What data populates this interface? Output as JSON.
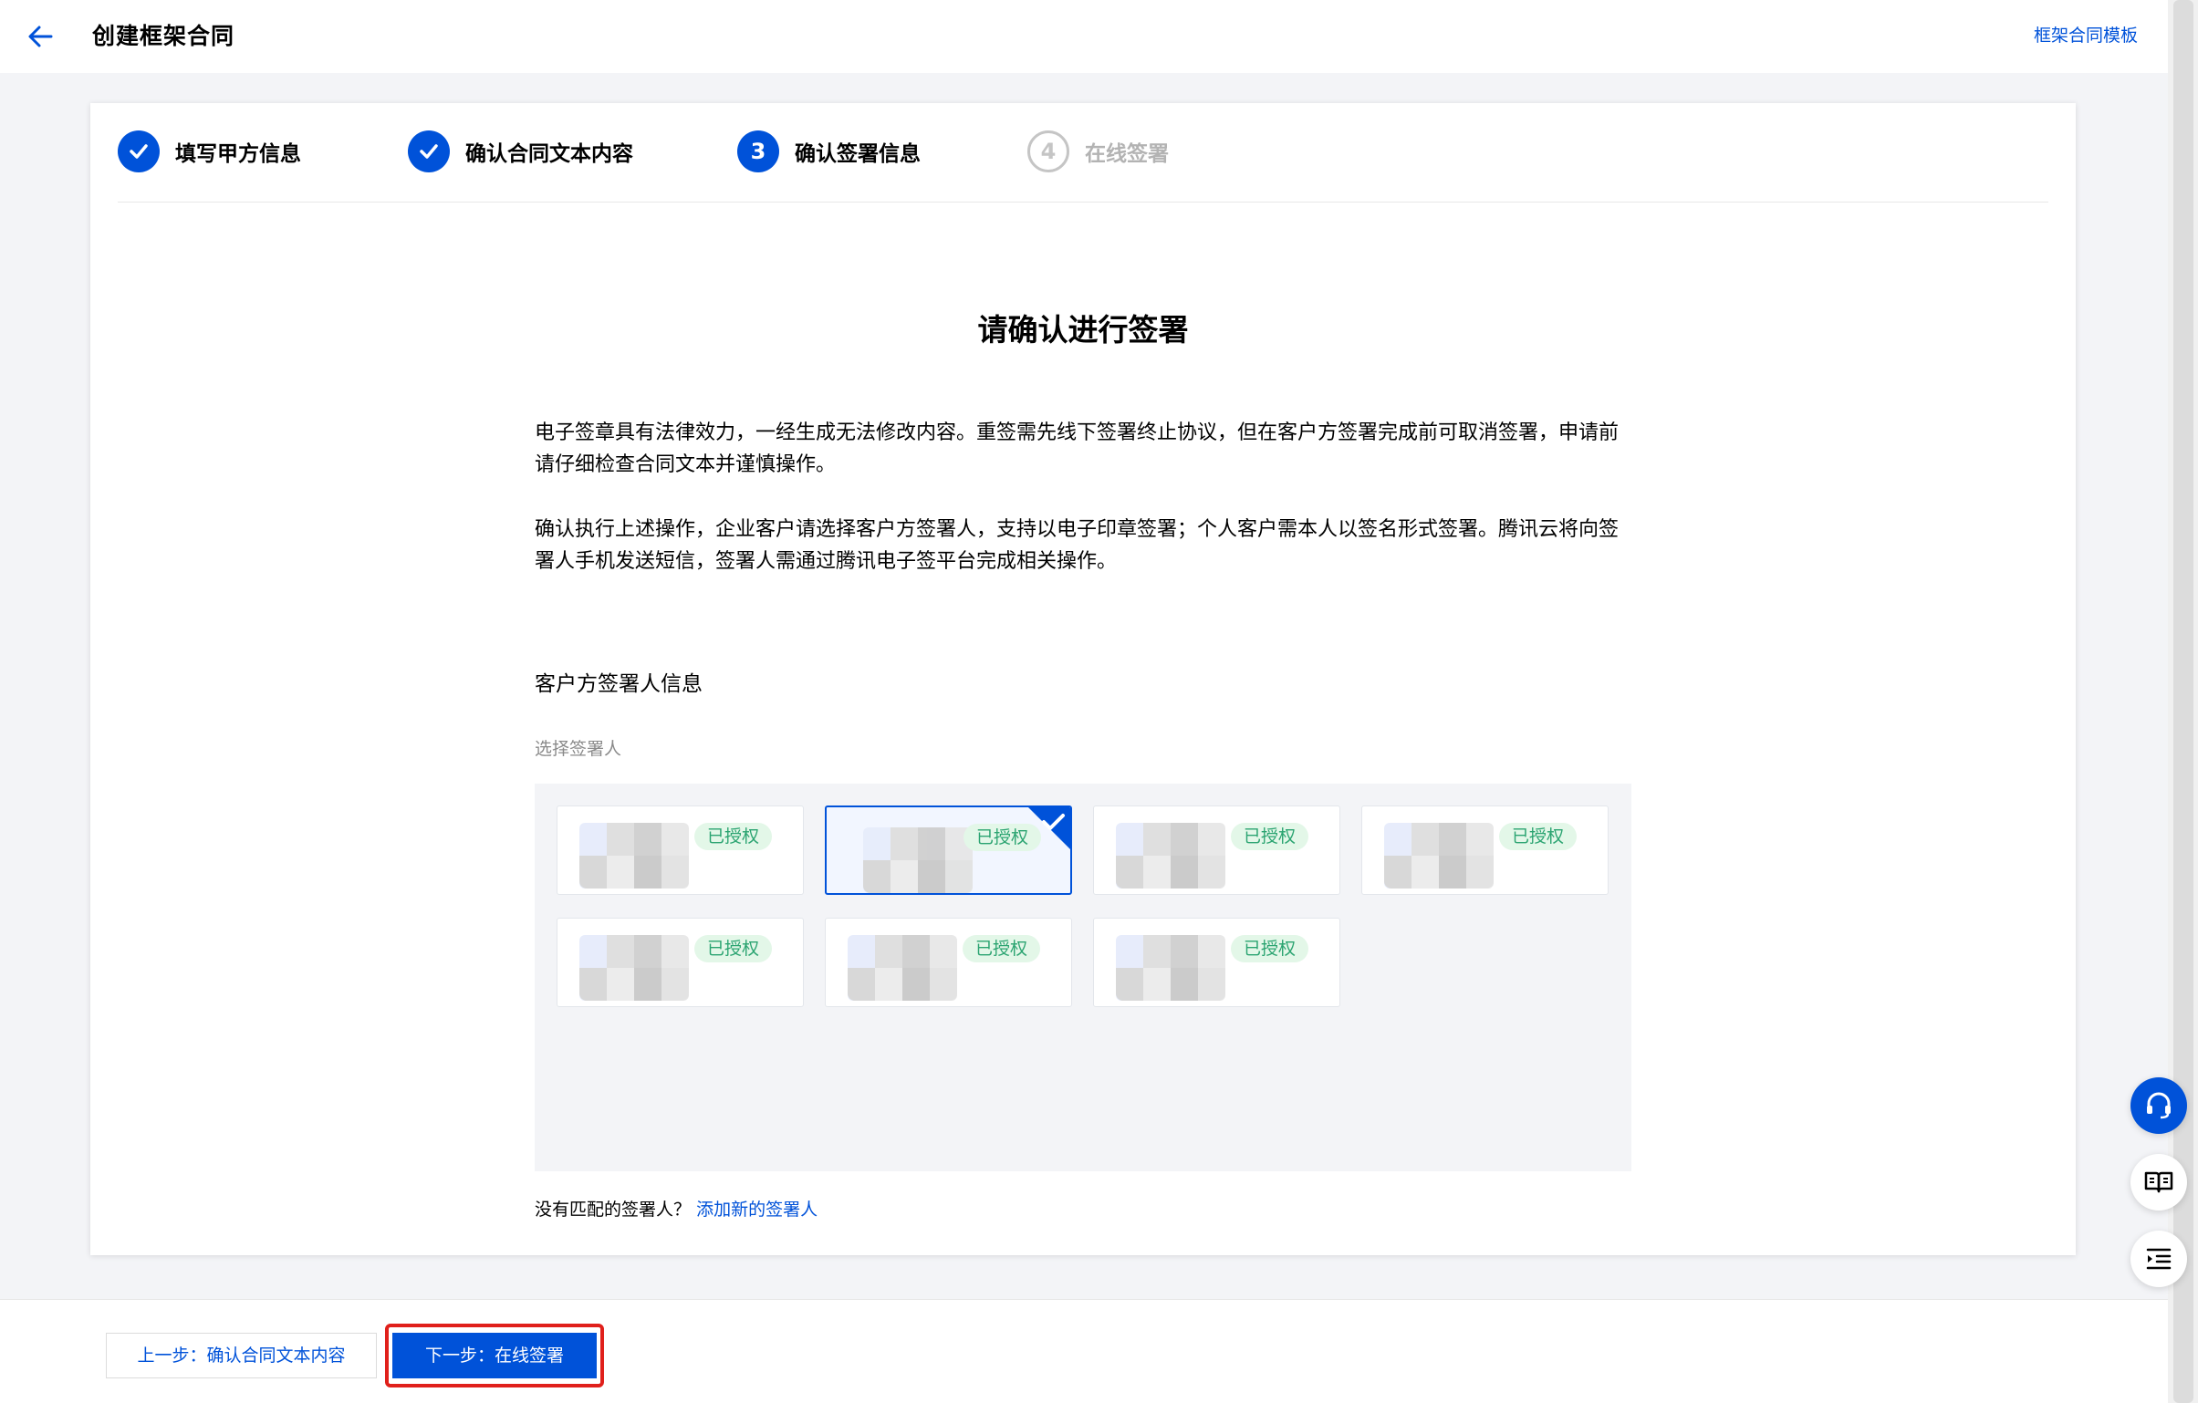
{
  "header": {
    "title": "创建框架合同",
    "template_link": "框架合同模板"
  },
  "steps": [
    {
      "number": "1",
      "label": "填写甲方信息",
      "status": "done"
    },
    {
      "number": "2",
      "label": "确认合同文本内容",
      "status": "done"
    },
    {
      "number": "3",
      "label": "确认签署信息",
      "status": "active"
    },
    {
      "number": "4",
      "label": "在线签署",
      "status": "pending"
    }
  ],
  "main": {
    "title": "请确认进行签署",
    "paragraph_1": "电子签章具有法律效力，一经生成无法修改内容。重签需先线下签署终止协议，但在客户方签署完成前可取消签署，申请前请仔细检查合同文本并谨慎操作。",
    "paragraph_2": "确认执行上述操作，企业客户请选择客户方签署人，支持以电子印章签署；个人客户需本人以签名形式签署。腾讯云将向签署人手机发送短信，签署人需通过腾讯电子签平台完成相关操作。",
    "signer_section_title": "客户方签署人信息",
    "select_label": "选择签署人",
    "signers": [
      {
        "badge": "已授权",
        "selected": false
      },
      {
        "badge": "已授权",
        "selected": true
      },
      {
        "badge": "已授权",
        "selected": false
      },
      {
        "badge": "已授权",
        "selected": false
      },
      {
        "badge": "已授权",
        "selected": false
      },
      {
        "badge": "已授权",
        "selected": false
      },
      {
        "badge": "已授权",
        "selected": false
      }
    ],
    "no_match_text": "没有匹配的签署人？",
    "add_signer_link": "添加新的签署人"
  },
  "footer": {
    "prev_label": "上一步：确认合同文本内容",
    "next_label": "下一步：在线签署"
  },
  "colors": {
    "primary": "#0052d9",
    "success_bg": "#e3f7e8",
    "success_text": "#2ba471",
    "highlight": "#e0201b"
  },
  "icons": {
    "back": "arrow-left-icon",
    "step_done": "check-icon",
    "step_separator": "chevron-right-icon",
    "float_1": "headset-icon",
    "float_2": "book-icon",
    "float_3": "list-indent-icon"
  }
}
